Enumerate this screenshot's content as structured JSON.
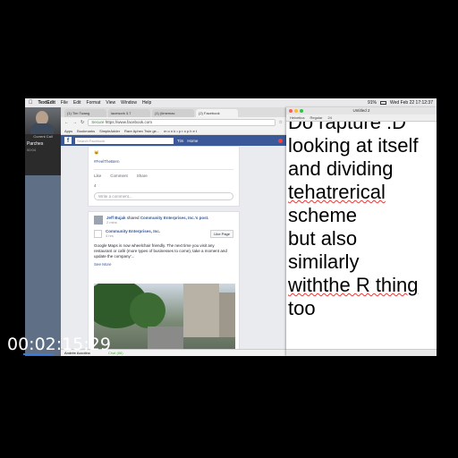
{
  "menubar": {
    "app_name": "TextEdit",
    "menus": [
      "File",
      "Edit",
      "Format",
      "View",
      "Window",
      "Help"
    ],
    "clock": "Wed Feb 22  17:12:37",
    "battery": "91%"
  },
  "call": {
    "status": "Current Call",
    "caller": "Parches",
    "duration": "00:04"
  },
  "browser": {
    "tabs": [
      "(1) Tim Twang",
      "lacework 3.7",
      "(1) (timemac",
      "(2) Facebook"
    ],
    "url_secure": "Secure",
    "url": "https://www.facebook.com",
    "bookmarks": [
      "Apps",
      "Bookmarks",
      "SimpleAdder",
      "Rare Aphex Twin ge...",
      "m o n k • p r o p h e t"
    ]
  },
  "facebook": {
    "search_placeholder": "Search Facebook",
    "user": "Tim",
    "home": "Home",
    "post1": {
      "hashtag": "#FeelTheBern",
      "like": "Like",
      "comment": "Comment",
      "share": "Share",
      "reaction_count": "4",
      "comment_placeholder": "Write a comment..."
    },
    "post2": {
      "author": "Jeff Bujak",
      "shared_text": "shared",
      "page_link": "Community Enterprises, Inc.'s post.",
      "time": "2 mins",
      "page_name": "Community Enterprises, Inc.",
      "page_time": "4 hrs",
      "like_page": "Like Page",
      "text": "Google Maps is now wheelchair friendly. The next time you visit any restaurant or café (more types of businesses to come), take a moment and update the company'...",
      "see_more": "See More"
    },
    "chatbar": {
      "left": "Andrée Azzolino",
      "right": "Chat (66)"
    }
  },
  "textedit": {
    "title": "Untitled 2",
    "font_family": "Helvetica",
    "font_style": "Regular",
    "font_size": "24",
    "lines": [
      "Do rapture :D",
      "looking at itself",
      "and dividing",
      "tehatrerical",
      "scheme",
      "but also",
      "similarly",
      "withthe R thing",
      "too"
    ]
  },
  "timecode": "00:02:15;29"
}
